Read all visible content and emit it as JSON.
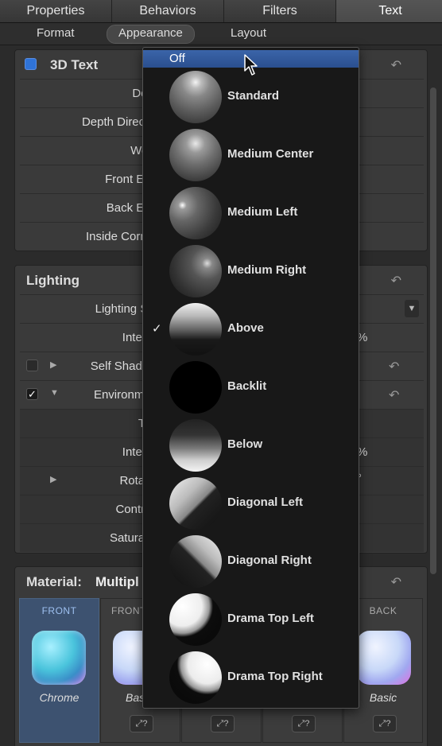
{
  "tabs": [
    "Properties",
    "Behaviors",
    "Filters",
    "Text"
  ],
  "subtabs": [
    "Format",
    "Appearance",
    "Layout"
  ],
  "text3d": {
    "title": "3D Text",
    "rows": [
      "Dept",
      "Depth Directio",
      "Weig",
      "Front Edg",
      "Back Edg",
      "Inside Corner"
    ]
  },
  "lighting": {
    "title": "Lighting",
    "style_label": "Lighting Sty",
    "intensity_label": "Intensi",
    "intensity_suffix": "%",
    "self_shadow_label": "Self Shadow",
    "environment_label": "Environmen",
    "env_rows": {
      "type": "Typ",
      "intensity": "Intensi",
      "intensity_suffix": "%",
      "rotation": "Rotatio",
      "rotation_suffix": "°",
      "contrast": "Contras",
      "saturation": "Saturatio"
    }
  },
  "material": {
    "label": "Material:",
    "value": "Multipl",
    "cells": [
      {
        "header": "FRONT",
        "name": "Chrome"
      },
      {
        "header": "FRONT",
        "name": "Bas"
      },
      {
        "header": "",
        "name": ""
      },
      {
        "header": "",
        "name": ""
      },
      {
        "header": "BACK",
        "name": "Basic"
      }
    ],
    "link_glyph": "⤢?"
  },
  "menu": {
    "off_label": "Off",
    "checked_item": "Above",
    "items": [
      "Standard",
      "Medium Center",
      "Medium Left",
      "Medium Right",
      "Above",
      "Backlit",
      "Below",
      "Diagonal Left",
      "Diagonal Right",
      "Drama Top Left",
      "Drama Top Right"
    ]
  },
  "colors": {
    "accent_blue": "#2f73d8",
    "menu_highlight": "#2f569a",
    "selected_material": "#3d5270"
  }
}
